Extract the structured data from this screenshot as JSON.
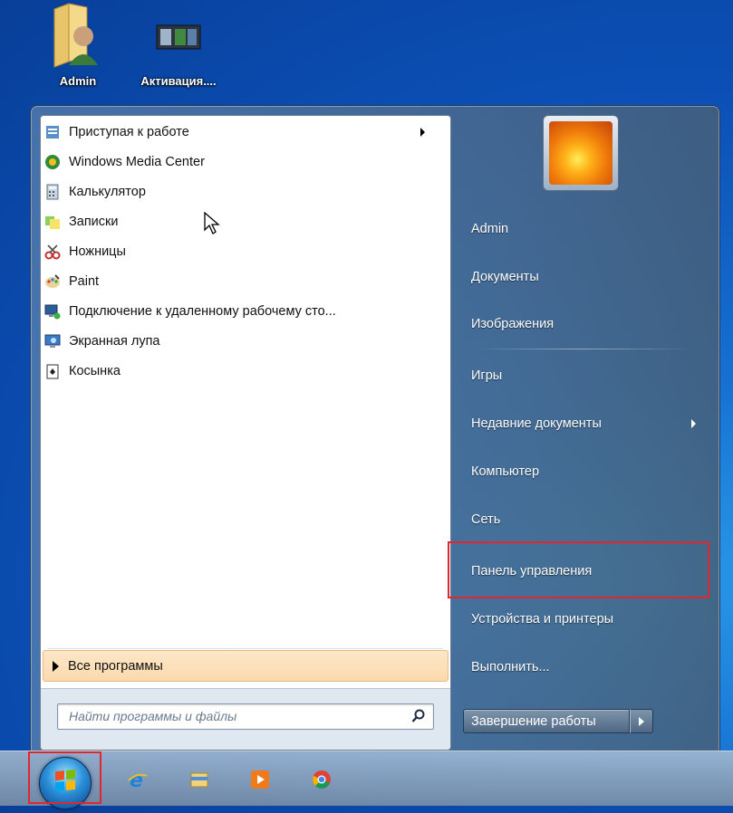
{
  "desktop": {
    "icons": [
      {
        "label": "Admin",
        "icon": "user-folder-icon"
      },
      {
        "label": "Активация....",
        "icon": "activation-shortcut-icon"
      }
    ]
  },
  "start_menu": {
    "programs": [
      {
        "label": "Приступая к работе",
        "icon": "getting-started-icon",
        "has_submenu": true
      },
      {
        "label": "Windows Media Center",
        "icon": "media-center-icon"
      },
      {
        "label": "Калькулятор",
        "icon": "calculator-icon"
      },
      {
        "label": "Записки",
        "icon": "sticky-notes-icon"
      },
      {
        "label": "Ножницы",
        "icon": "snipping-tool-icon"
      },
      {
        "label": "Paint",
        "icon": "paint-icon"
      },
      {
        "label": "Подключение к удаленному рабочему сто...",
        "icon": "remote-desktop-icon"
      },
      {
        "label": "Экранная лупа",
        "icon": "magnifier-icon"
      },
      {
        "label": "Косынка",
        "icon": "solitaire-icon"
      }
    ],
    "all_programs_label": "Все программы",
    "search_placeholder": "Найти программы и файлы",
    "right_items": [
      {
        "label": "Admin"
      },
      {
        "label": "Документы"
      },
      {
        "label": "Изображения"
      },
      {
        "label": "Игры"
      },
      {
        "label": "Недавние документы",
        "has_submenu": true
      },
      {
        "label": "Компьютер"
      },
      {
        "label": "Сеть"
      },
      {
        "label": "Панель управления",
        "highlighted": true
      },
      {
        "label": "Устройства и принтеры"
      },
      {
        "label": "Выполнить..."
      }
    ],
    "shutdown_label": "Завершение работы"
  },
  "taskbar": {
    "items": [
      "start-orb-icon",
      "internet-explorer-icon",
      "explorer-icon",
      "media-player-icon",
      "chrome-icon"
    ]
  },
  "colors": {
    "highlight": "#e0272e",
    "accent": "#1670d2"
  }
}
